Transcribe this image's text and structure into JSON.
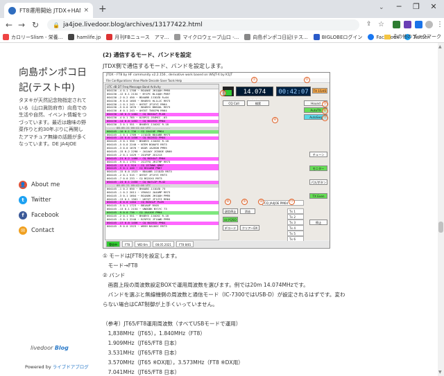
{
  "browser": {
    "tab_title": "FT8運用開始 JTDX+HAMLOG（3",
    "tab_close": "×",
    "new_tab": "+",
    "url": "ja4joe.livedoor.blog/archives/13177422.html",
    "bookmarks": [
      {
        "label": "カロリーSlism - 栄養...",
        "color": "#e44"
      },
      {
        "label": "hamlife.jp",
        "color": "#444"
      },
      {
        "label": "月刊FBニュース　アマ...",
        "color": "#d33"
      },
      {
        "label": "マイクロウェーブ山口 -...",
        "color": "#999"
      },
      {
        "label": "向島ポンポコ日記(テス...",
        "color": "#888"
      },
      {
        "label": "BIGLOBEログイン",
        "color": "#2a5ac9"
      },
      {
        "label": "Facebook",
        "color": "#1877f2"
      },
      {
        "label": "Twitter",
        "color": "#1da1f2"
      }
    ],
    "other_bookmarks": "その他のブックマーク"
  },
  "sidebar": {
    "blog_title": "向島ポンポコ日記(テスト中)",
    "description": "タヌキが天然記念物指定されている（山口眞防府市）向島での生活や自然、イベント情報をつづっています。最近は趣味の野菜作りと約30年ぶりに再開したアマチュア無線の話題が多くなっています。DE JA4JOE",
    "links": [
      {
        "label": "About me",
        "color": "#e0533a",
        "glyph": "👤"
      },
      {
        "label": "Twitter",
        "color": "#1da1f2",
        "glyph": "t"
      },
      {
        "label": "Facebook",
        "color": "#3b5998",
        "glyph": "f"
      },
      {
        "label": "Contact",
        "color": "#f0a020",
        "glyph": "✉"
      }
    ],
    "livedoor": "livedoor",
    "blog_word": "Blog",
    "powered_prefix": "Powered by ",
    "powered_link": "ライブドアブログ"
  },
  "article": {
    "heading": "(2) 通信するモード、バンドを設定",
    "intro": "JTDX側で通信するモード、バンドを設定します。",
    "lines": [
      "① モードは[FT8]を設定します。",
      "　モード→FT8",
      "② バンド",
      "　画面上段の周波数設定BOXで運用周波数を選びます。例では20m 14.074MHzです。",
      "　バンドを選ぶと無線機側の周波数と通信モード（IC-7300ではUSB-D）が設定されるはずです。変わ",
      "らない場合はCAT制御が上手くいっていません。",
      "",
      "（参考）JT65/FT8運用周波数（すべてUSBモードで運用）",
      "　1,838MHz（JT65），1.840MHz（FT8）",
      "　1.909MHz（JT65/FT8 日本）",
      "　3.531MHz（JT65/FT8 日本）",
      "　3.570MHz（JT65 ※DX用），3.573MHz（FT8 ※DX用）",
      "　7.041MHz（JT65/FT8 日本）"
    ]
  },
  "jtdx": {
    "window_title": "JTDX - FT8 by HF community                 v2.2.156 , derivative work based on WSJT-X by K1JT",
    "menu": "File  Configurations  View  Mode  Decode  Save  Tools  Help",
    "decode_header": "UTC     dB  DT  Freq    Message               Band Activity",
    "frequency": "14.074 000",
    "clock": "00:42:07",
    "signal_level": 0.7,
    "decode_lines": [
      {
        "t": "004130  -4  0.1 1708 ~  BG4AKE JH1QQH PM95",
        "k": "n"
      },
      {
        "t": "004130 -12  0.1 2134 ~  BY1PC BL1QQH  PN97",
        "k": "n"
      },
      {
        "t": "004130  -2  0.2  450 ~  BD4ABB JJ1DZD R+04",
        "k": "n"
      },
      {
        "t": "004130  -9  0.0 1605 ~  BH4BYX HL1LJC RR73",
        "k": "n"
      },
      {
        "t": "004130  -1  0.1  243 ~  UH7OT JF1VYI RR64",
        "k": "n"
      },
      {
        "t": "004130  -5  0.0 1676 ~  BH4BYX BH6GOL RR73",
        "k": "n"
      },
      {
        "t": "004130  -6  0.1  243 ~  UH7OT TN5CPN RR64",
        "k": "n"
      },
      {
        "t": "004130 -18  0.3 1404 ~  CQ BG5GLP PL09",
        "k": "cq"
      },
      {
        "t": "004130  -4  0.1  785 ~  8J5PCG JE4MCC -03",
        "k": "n"
      },
      {
        "t": "004130 -14  0.0 1452 ~  CQ BX2ECD PM04",
        "k": "cq"
      },
      {
        "t": "004130  -3  0.1  551 ~  BH4BYX JJ4OSC R-18",
        "k": "n"
      },
      {
        "t": "----- 08.05.21 00:41:44 UTC -----------",
        "k": "sep"
      },
      {
        "t": "004145 -10  0.1  736 ~  CQ JA4JOE PM64",
        "k": "me"
      },
      {
        "t": "004145  -1  0.1 1709 ~  JJ1DZD BD4ABB RR73",
        "k": "n"
      },
      {
        "t": "004145 -15  0.0 1456 ~  CQ BX2ECD PM04",
        "k": "cq"
      },
      {
        "t": "004145  -3  0.1  550 ~  BH4BYX JJ4OSC R-18",
        "k": "n"
      },
      {
        "t": "004145  -5  0.0 2240 ~  N7EM BG6AFE RR73",
        "k": "n"
      },
      {
        "t": "004145  -3  0.0 1676 ~  W1DR JA2EDB PM95",
        "k": "n"
      },
      {
        "t": "004145 -15  0.2 2290 ~  JA1AAY JG5OOE QR00",
        "k": "n"
      },
      {
        "t": "004145  -2  0.1 1429 ~  JO1PAP  JG1213",
        "k": "n"
      },
      {
        "t": "004145 -21  0.2 1400 ~  CQ BG5GLP PM04",
        "k": "cq"
      },
      {
        "t": "004145  -9  0.1 1791 ~  JG1TFQ JR1TMP RR73",
        "k": "n"
      },
      {
        "t": "004145 -12  0.1  924 ~  CQ JE7WWG QM07",
        "k": "cq"
      },
      {
        "t": "004145  -5  0.1  440 ~  CQ BG1ABB PN67",
        "k": "cq"
      },
      {
        "t": "004145 -15  0.0 1523 ~  BD4ABB JJ1DZD RR73",
        "k": "n"
      },
      {
        "t": "004145  -2  0.1  515 ~  UH7OT JF1VYI RR73",
        "k": "n"
      },
      {
        "t": "004145  -7  0.0  233 ~  CQ BG2XXX RR73",
        "k": "n"
      },
      {
        "t": "004145 -24  0.1 2450 ~  CQ BA7LIP PL42",
        "k": "cq"
      },
      {
        "t": "----- 08.05.21 00:42:00 UTC -----------",
        "k": "sep"
      },
      {
        "t": "004145  -1  0.2  650 ~  BH4ABS JJ1DZD 73",
        "k": "n"
      },
      {
        "t": "004145  -1  0.2 2011 ~  VE6AGJ JA4AMP RR73",
        "k": "n"
      },
      {
        "t": "004145  -3  0.1 1604 ~  BG4ABK JH1QQH PM95",
        "k": "n"
      },
      {
        "t": "004145 -13  0.1 1501 ~  UH7OT JF1VYI RR64",
        "k": "n"
      },
      {
        "t": "004145  -8  0.0 1404 ~  CQ BG5GLP PL09",
        "k": "cq"
      },
      {
        "t": "004145  -5  0.1 1723 ~  BB1AUP RV05",
        "k": "n"
      },
      {
        "t": "004145 -13  0.1 2154 ~  UN0GBK NY1YC 73",
        "k": "n"
      },
      {
        "t": "004145  -9  0.0  736 ~  CQ JA4JOE PM64",
        "k": "me"
      },
      {
        "t": "004145  -2  0.1  551 ~  BH4BYX JJ4OSC R-18",
        "k": "n"
      },
      {
        "t": "004145  -3  0.1 2240 ~  BJ5PCG JF1AWD PM95",
        "k": "n"
      },
      {
        "t": "004145 -17  0.0 1456 ~  CQ BX2ECD PM04",
        "k": "cq"
      },
      {
        "t": "004145  -9  0.0 1523 ~  W9VH BA100C RR73",
        "k": "n"
      }
    ],
    "buttons": {
      "cq": "CQ Call",
      "tx_watch": "TX 15/45",
      "hound": "Hound",
      "auto_tx": "AutoTX",
      "auto_seq": "AutoSeq",
      "tune": "チューン",
      "monitor": "モニター",
      "tx1": "パス/ボタン",
      "tx_even": "TX Even",
      "erase": "消去",
      "decode": "デコード",
      "log_qso": "ログQSO",
      "clear_dx": "クリアーDX",
      "stop": "停止",
      "halt": "送信停止",
      "lookup": "検索"
    },
    "tx_rows": [
      "Tx 1",
      "Tx 2",
      "Tx 3",
      "Tx 4",
      "Tx 5",
      "Tx 6"
    ],
    "dx_call": "CQ JA4JOE PM64",
    "status": {
      "mode": "受信中",
      "band": "FT8",
      "rx_freq": "WD:6m",
      "date": "08.05.2021",
      "tx_mode": "FT8 8/81"
    },
    "markers": [
      "①",
      "②",
      "③",
      "④",
      "⑤",
      "⑥",
      "⑦",
      "⑧",
      "⑨",
      "⑩",
      "⑪"
    ]
  }
}
